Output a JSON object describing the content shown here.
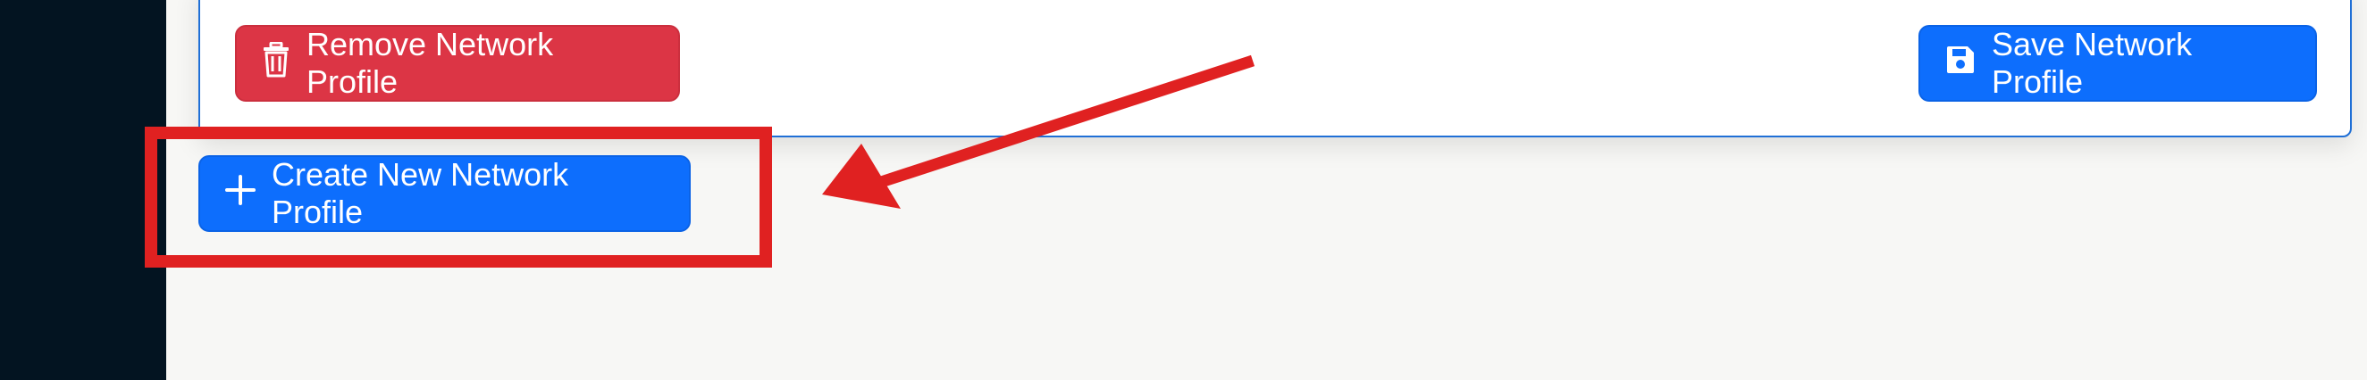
{
  "card": {
    "remove_button_label": "Remove Network Profile",
    "save_button_label": "Save Network Profile"
  },
  "actions": {
    "create_button_label": "Create New Network Profile"
  },
  "icons": {
    "remove": "trash-icon",
    "save": "floppy-disk-icon",
    "create": "plus-icon"
  },
  "colors": {
    "danger": "#dc3545",
    "primary": "#0d6efd",
    "sidebar": "#031421",
    "annotation": "#e02121"
  }
}
